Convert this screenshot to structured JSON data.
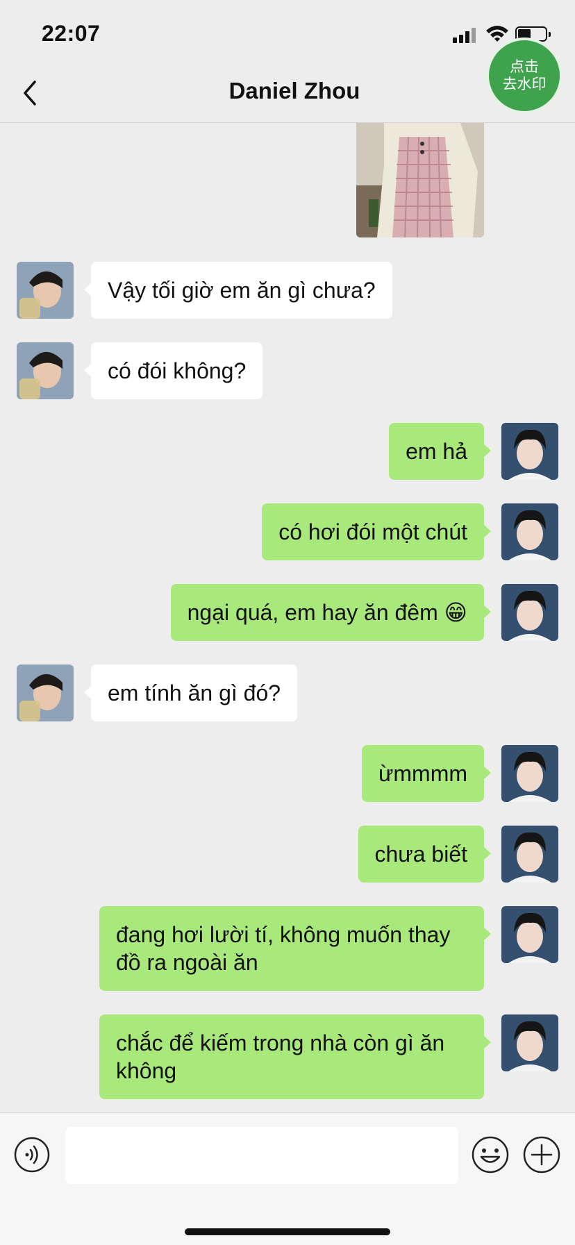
{
  "status_bar": {
    "time": "22:07"
  },
  "watermark_button": {
    "line1": "点击",
    "line2": "去水印"
  },
  "header": {
    "title": "Daniel Zhou"
  },
  "messages": [
    {
      "side": "left",
      "text": "Vậy tối giờ em ăn gì chưa?"
    },
    {
      "side": "left",
      "text": "có đói không?"
    },
    {
      "side": "right",
      "text": "em hả"
    },
    {
      "side": "right",
      "text": "có hơi đói một chút"
    },
    {
      "side": "right",
      "text": "ngại quá, em hay ăn đêm 😁"
    },
    {
      "side": "left",
      "text": "em tính ăn gì đó?"
    },
    {
      "side": "right",
      "text": "ừmmmm"
    },
    {
      "side": "right",
      "text": "chưa biết"
    },
    {
      "side": "right",
      "text": "đang hơi lười tí, không muốn thay đồ ra ngoài ăn"
    },
    {
      "side": "right",
      "text": "chắc để kiếm trong nhà còn gì ăn không"
    }
  ],
  "input_bar": {
    "value": ""
  },
  "colors": {
    "outgoing_bubble": "#a9e87a",
    "incoming_bubble": "#ffffff",
    "background": "#ededed",
    "watermark_button": "#3fa34d"
  },
  "icons": {
    "back": "chevron-left-icon",
    "voice": "voice-icon",
    "emoji": "emoji-icon",
    "plus": "plus-icon"
  }
}
